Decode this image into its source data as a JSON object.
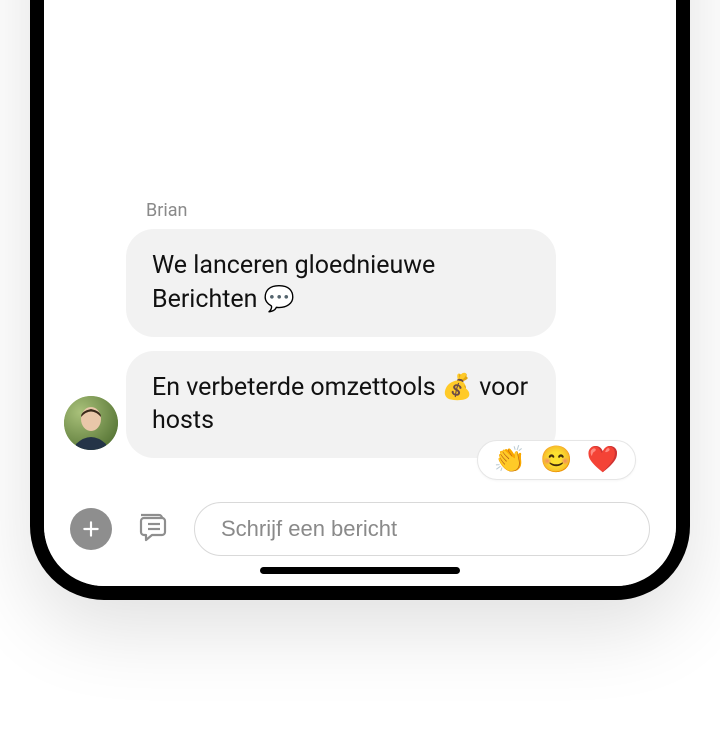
{
  "sender": {
    "name": "Brian"
  },
  "messages": [
    {
      "text": "We lanceren gloednieuwe Berichten 💬"
    },
    {
      "text": "En verbeterde omzettools 💰 voor hosts"
    }
  ],
  "reactions": {
    "items": [
      {
        "emoji": "👏"
      },
      {
        "emoji": "😊"
      },
      {
        "emoji": "❤️"
      }
    ]
  },
  "composer": {
    "placeholder": "Schrijf een bericht",
    "value": ""
  },
  "icons": {
    "add": "add-icon",
    "saved_replies": "saved-replies-icon"
  }
}
